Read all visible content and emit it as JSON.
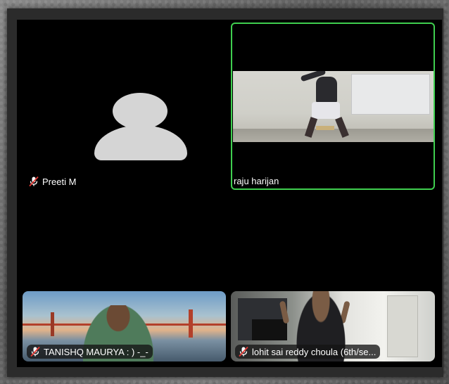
{
  "participants": [
    {
      "name": "Preeti M",
      "muted": true,
      "video": false
    },
    {
      "name": "raju harijan",
      "muted": false,
      "video": true,
      "active_speaker": true
    },
    {
      "name": "TANISHQ MAURYA : ) -_-",
      "muted": true,
      "video": true
    },
    {
      "name": "lohit sai reddy choula (6th/se...",
      "muted": true,
      "video": true
    }
  ],
  "colors": {
    "active_border": "#3fcf4f",
    "mic_muted": "#e53935",
    "stage_background": "#000000"
  },
  "icons": {
    "muted_mic": "mic-off-icon",
    "avatar": "avatar-placeholder-icon"
  }
}
